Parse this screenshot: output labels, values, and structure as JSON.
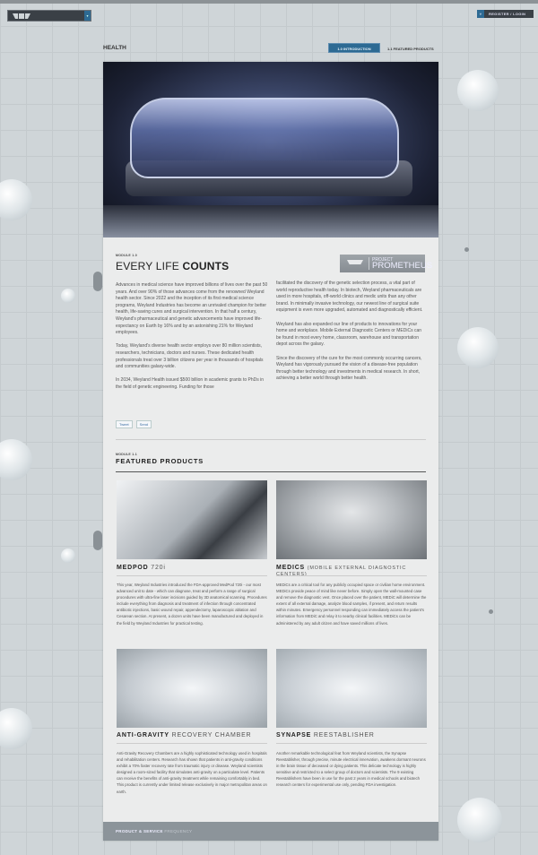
{
  "header": {
    "register_label": "REGISTER / LOGIN",
    "section_title": "HEALTH"
  },
  "tabs": [
    {
      "label": "1.0 INTRODUCTION",
      "active": true
    },
    {
      "label": "1.1 FEATURED PRODUCTS",
      "active": false
    }
  ],
  "intro": {
    "module": "MODULE 1.0",
    "title_light": "EVERY LIFE",
    "title_bold": "COUNTS",
    "badge_small": "PROJECT",
    "badge_large": "PROMETHEUS",
    "col1": [
      "Advances in medical science have improved billions of lives over the past 50 years.  And over 90% of those advances come from the renowned Weyland health sector. Since 2022 and the inception of its first medical science programs, Weyland Industries has become an unrivaled champion for better health, life-saving cures and surgical intervention. In that half a century, Weyland's pharmaceutical and genetic advancements have improved life-expectancy on Earth by 16% and by an astonishing 21% for Weyland employees.",
      "Today, Weyland's diverse health sector employs over 80 million scientists, researchers, technicians, doctors and nurses.  These dedicated health professionals treat over 3 billion citizens per year in thousands of hospitals and communities galaxy-wide.",
      "In 2034, Weyland Health issued $500 billion in academic grants to PhDs in the field of genetic engineering.  Funding for those"
    ],
    "col2": [
      "facilitated the discovery of the genetic selection process, a vital part of world reproductive health today.  In biotech, Weyland pharmaceuticals are used in more hospitals, off-world clinics and medic units than any other brand.  In minimally invasive technology, our newest line of surgical suite equipment is even more upgraded, automated and diagnostically efficient.",
      "Weyland has also expanded our line of products to innovations for your home and workplace.  Mobile External Diagnostic Centers or MEDiCs can be found in most every home, classroom, warehouse and transportation depot across the galaxy.",
      "Since the discovery of the cure for the most commonly occurring cancers, Weyland has vigorously pursued the vision of a disease-free population through better technology and investments in medical research.  In short, achieving a better world through better health."
    ],
    "share": {
      "tweet": "Tweet",
      "send": "Send"
    }
  },
  "products": {
    "module": "MODULE 1.1",
    "title": "FEATURED PRODUCTS",
    "items": [
      {
        "bold": "MEDPOD",
        "light": "720i",
        "text": "This year, Weyland Industries introduced the FDA-approved MedPod 720i - our most advanced unit to date -  which can diagnose, treat and perform a range of surgical procedures with ultra-fine laser incisions guided by 3D anatomical scanning.  Procedures include everything from diagnosis and treatment of infection through concentrated antibiotic injections, basic wound repair, appendectomy, laparoscopic ablation and Cesarean section. At present, a dozen units have been manufactured and deployed in the field by Weyland Industries for practical testing."
      },
      {
        "bold": "MEDICS",
        "light": "(MOBILE EXTERNAL DIAGNOSTIC CENTERS)",
        "text": "MEDiCs are a critical tool for any publicly occupied space or civilian home environment.  MEDiCs provide peace of mind like never before. Simply open the wall-mounted case and remove the diagnostic vest. Once placed over the patient, MEDiC will determine the extent of all external damage, analyze blood samples, if present, and return results within minutes.  Emergency personnel responding can immediately access the patient's information from MEDiC and relay it to nearby clinical facilities.  MEDiCs can be administered by any adult citizen and have saved millions of lives."
      },
      {
        "bold": "ANTI-GRAVITY",
        "light": "RECOVERY CHAMBER",
        "text": "Anti-Gravity Recovery Chambers are a highly sophisticated technology used in hospitals and rehabilitation centers.  Research has shown that patients in anti-gravity conditions exhibit a 70% faster recovery rate from traumatic injury or disease. Weyland scientists designed a room-sized facility that simulates anti-gravity on a particulate level.  Patients can receive the benefits of anti-gravity treatment while remaining comfortably in bed. This product is currently under limited release exclusively in major metropolitan areas on earth."
      },
      {
        "bold": "SYNAPSE",
        "light": "REESTABLISHER",
        "text": "Another remarkable technological feat from Weyland scientists, the Synapse Reestablisher, through precise, minute electrical innervation, awakens dormant neurons in the brain tissue of deceased or dying patients.  This delicate technology is highly sensitive and restricted to a select group of doctors and scientists.  The 9 existing Reestablishers have been in use for the past 2 years in medical schools and biotech research centers for experimental use only, pending FDA investigation."
      }
    ]
  },
  "footer": {
    "bold": "PRODUCT & SERVICE",
    "light": "FREQUENCY"
  },
  "colors": {
    "accent": "#2d6a93",
    "dark": "#3a4046",
    "footer": "#8c949a"
  }
}
